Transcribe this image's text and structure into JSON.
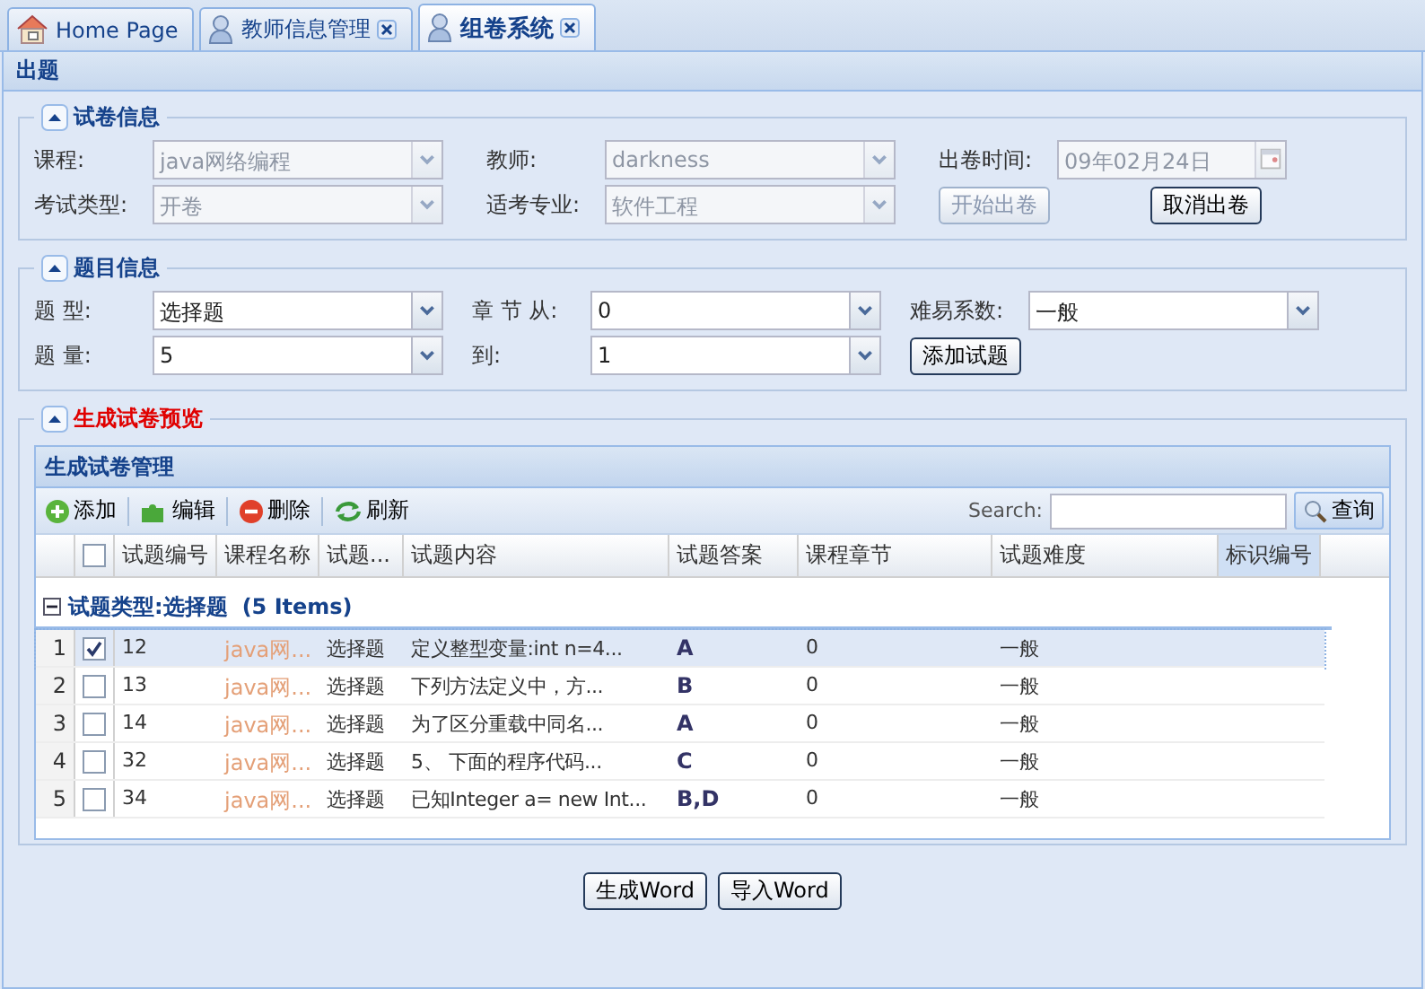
{
  "tabs": [
    {
      "label": "Home Page",
      "kind": "home",
      "selected": false,
      "closable": false
    },
    {
      "label": "教师信息管理",
      "kind": "user",
      "selected": false,
      "closable": true
    },
    {
      "label": "组卷系统",
      "kind": "user",
      "selected": true,
      "closable": true
    }
  ],
  "panel": {
    "title": "出题"
  },
  "paper_info": {
    "title": "试卷信息",
    "expanded": true,
    "fields": [
      {
        "label": "课程:",
        "value": "java网络编程",
        "kind": "combo",
        "disabled": true
      },
      {
        "label": "教师:",
        "value": "darkness",
        "kind": "combo",
        "disabled": true
      },
      {
        "label": "出卷时间:",
        "value": "09年02月24日",
        "kind": "date",
        "disabled": true
      },
      {
        "label": "考试类型:",
        "value": "开卷",
        "kind": "combo",
        "disabled": true
      },
      {
        "label": "适考专业:",
        "value": "软件工程",
        "kind": "combo",
        "disabled": true
      }
    ],
    "buttons": [
      {
        "label": "开始出卷",
        "disabled": true
      },
      {
        "label": "取消出卷",
        "disabled": false
      }
    ]
  },
  "question_info": {
    "title": "题目信息",
    "expanded": true,
    "fields": [
      {
        "label": "题 型:",
        "value": "选择题",
        "kind": "combo",
        "disabled": false
      },
      {
        "label": "章 节 从:",
        "value": "0",
        "kind": "combo",
        "disabled": false
      },
      {
        "label": "难易系数:",
        "value": "一般",
        "kind": "combo",
        "disabled": false
      },
      {
        "label": "题 量:",
        "value": "5",
        "kind": "combo",
        "disabled": false
      },
      {
        "label": "到:",
        "value": "1",
        "kind": "combo",
        "disabled": false
      }
    ],
    "buttons": [
      {
        "label": "添加试题",
        "disabled": false
      }
    ]
  },
  "preview": {
    "title": "生成试卷预览",
    "expanded": true,
    "grid": {
      "title": "生成试卷管理",
      "toolbar": [
        {
          "label": "添加",
          "kind": "add"
        },
        {
          "label": "编辑",
          "kind": "edit"
        },
        {
          "label": "删除",
          "kind": "delete"
        },
        {
          "label": "刷新",
          "kind": "refresh"
        }
      ],
      "search": {
        "label": "Search:",
        "button": "查询"
      },
      "header_checked": false,
      "columns": [
        {
          "label": "试题编号",
          "highlighted": false
        },
        {
          "label": "课程名称",
          "highlighted": false
        },
        {
          "label": "试题...",
          "highlighted": false
        },
        {
          "label": "试题内容",
          "highlighted": false
        },
        {
          "label": "试题答案",
          "highlighted": false
        },
        {
          "label": "课程章节",
          "highlighted": false
        },
        {
          "label": "试题难度",
          "highlighted": false
        },
        {
          "label": "标识编号",
          "highlighted": true
        }
      ],
      "group": {
        "label": "试题类型:选择题",
        "count": "(5 Items)",
        "expanded": true
      },
      "rows": [
        {
          "index": "1",
          "selected": true,
          "checked": true,
          "cells": [
            "12",
            "java网...",
            "选择题",
            "定义整型变量:int n=4...",
            "A",
            "0",
            "一般"
          ]
        },
        {
          "index": "2",
          "selected": false,
          "checked": false,
          "cells": [
            "13",
            "java网...",
            "选择题",
            "下列方法定义中，方...",
            "B",
            "0",
            "一般"
          ]
        },
        {
          "index": "3",
          "selected": false,
          "checked": false,
          "cells": [
            "14",
            "java网...",
            "选择题",
            "为了区分重载中同名...",
            "A",
            "0",
            "一般"
          ]
        },
        {
          "index": "4",
          "selected": false,
          "checked": false,
          "cells": [
            "32",
            "java网...",
            "选择题",
            "5、 下面的程序代码...",
            "C",
            "0",
            "一般"
          ]
        },
        {
          "index": "5",
          "selected": false,
          "checked": false,
          "cells": [
            "34",
            "java网...",
            "选择题",
            "已知Integer a= new Int...",
            "B,D",
            "0",
            "一般"
          ]
        }
      ]
    }
  },
  "footer_buttons": [
    "生成Word",
    "导入Word"
  ]
}
